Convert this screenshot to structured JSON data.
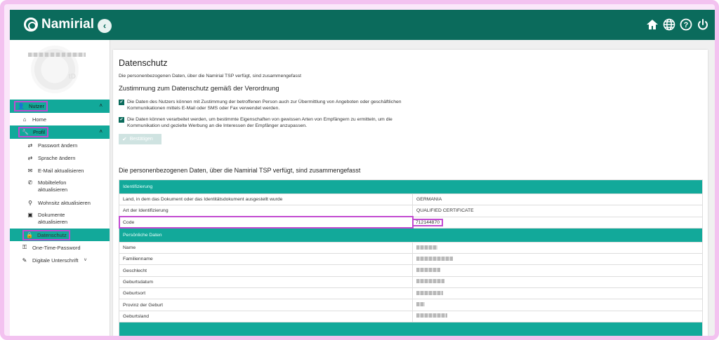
{
  "header": {
    "logo_text": "Namirial",
    "collapse_icon": "chevron-left",
    "icons": [
      "home-icon",
      "globe-icon",
      "help-icon",
      "power-icon"
    ]
  },
  "sidebar": {
    "user_group": "Nutzer",
    "items": [
      {
        "label": "Home",
        "icon": "home-icon"
      },
      {
        "label": "Profil",
        "icon": "wrench-icon"
      },
      {
        "label": "Passwort ändern",
        "icon": "arrows-icon"
      },
      {
        "label": "Sprache ändern",
        "icon": "arrows-icon"
      },
      {
        "label": "E-Mail aktualisieren",
        "icon": "envelope-icon"
      },
      {
        "label": "Mobiltelefon aktualisieren",
        "icon": "phone-icon"
      },
      {
        "label": "Wohnsitz aktualisieren",
        "icon": "pin-icon"
      },
      {
        "label": "Dokumente aktualisieren",
        "icon": "id-card-icon"
      },
      {
        "label": "Datenschutz",
        "icon": "lock-icon"
      },
      {
        "label": "One-Time-Password",
        "icon": "key-icon"
      },
      {
        "label": "Digitale Unterschrift",
        "icon": "signature-icon"
      }
    ]
  },
  "main": {
    "title": "Datenschutz",
    "intro": "Die personenbezogenen Daten, über die Namirial TSP verfügt, sind zusammengefasst",
    "consent_heading": "Zustimmung zum Datenschutz gemäß der Verordnung",
    "consent1": "Die Daten des Nutzers können mit Zustimmung der betroffenen Person auch zur Übermittlung von Angeboten oder geschäftlichen Kommunikationen mittels E-Mail oder SMS oder Fax verwendet werden.",
    "consent2": "Die Daten können verarbeitet werden, um bestimmte Eigenschaften von gewissen Arten von Empfängern zu ermitteln, um die Kommunikation und gezielte Werbung an die Interessen der Empfänger anzupassen.",
    "confirm_label": "Bestätigen",
    "summary_heading": "Die personenbezogenen Daten, über die Namirial TSP verfügt, sind zusammengefasst",
    "table": {
      "section1": "Identifizierung",
      "rows1": [
        {
          "label": "Land, in dem das Dokument oder das Identitätsdokument ausgestellt wurde",
          "value": "GERMANIA"
        },
        {
          "label": "Art der Identifizierung",
          "value": "QUALIFIED CERTIFICATE"
        },
        {
          "label": "Code",
          "value": "712144870"
        }
      ],
      "section2": "Persönliche Daten",
      "rows2": [
        {
          "label": "Name"
        },
        {
          "label": "Familienname"
        },
        {
          "label": "Geschlecht"
        },
        {
          "label": "Geburtsdatum"
        },
        {
          "label": "Geburtsort"
        },
        {
          "label": "Provinz der Geburt"
        },
        {
          "label": "Geburtsland"
        }
      ]
    }
  }
}
